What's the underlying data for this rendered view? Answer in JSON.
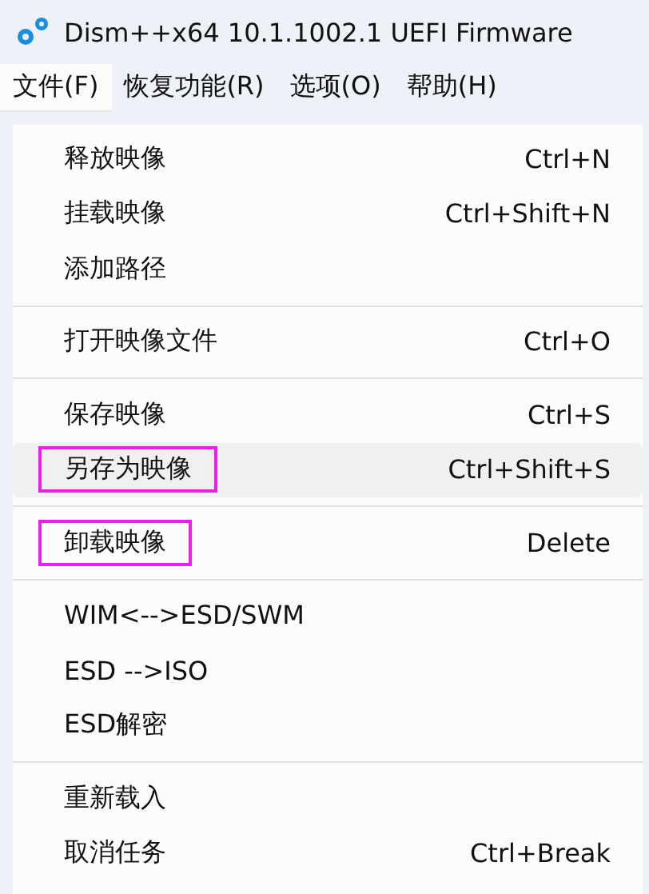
{
  "window": {
    "title": "Dism++x64 10.1.1002.1 UEFI Firmware"
  },
  "menubar": [
    {
      "label": "文件(F)",
      "selected": true
    },
    {
      "label": "恢复功能(R)",
      "selected": false
    },
    {
      "label": "选项(O)",
      "selected": false
    },
    {
      "label": "帮助(H)",
      "selected": false
    }
  ],
  "menu": {
    "groups": [
      {
        "items": [
          {
            "label": "释放映像",
            "shortcut": "Ctrl+N",
            "selected": false,
            "marked": false
          },
          {
            "label": "挂载映像",
            "shortcut": "Ctrl+Shift+N",
            "selected": false,
            "marked": false
          },
          {
            "label": "添加路径",
            "selected": false,
            "marked": false
          }
        ]
      },
      {
        "items": [
          {
            "label": "打开映像文件",
            "shortcut": "Ctrl+O",
            "selected": false,
            "marked": false
          }
        ]
      },
      {
        "items": [
          {
            "label": "保存映像",
            "shortcut": "Ctrl+S",
            "selected": false,
            "marked": false
          },
          {
            "label": "另存为映像",
            "shortcut": "Ctrl+Shift+S",
            "selected": true,
            "marked": true
          }
        ]
      },
      {
        "items": [
          {
            "label": "卸载映像",
            "shortcut": "Delete",
            "selected": false,
            "marked": true
          }
        ]
      },
      {
        "items": [
          {
            "label": "WIM<-->ESD/SWM",
            "selected": false,
            "marked": false
          },
          {
            "label": "ESD -->ISO",
            "selected": false,
            "marked": false
          },
          {
            "label": "ESD解密",
            "selected": false,
            "marked": false
          }
        ]
      },
      {
        "items": [
          {
            "label": "重新载入",
            "selected": false,
            "marked": false
          },
          {
            "label": "取消任务",
            "shortcut": "Ctrl+Break",
            "selected": false,
            "marked": false
          }
        ]
      }
    ]
  }
}
